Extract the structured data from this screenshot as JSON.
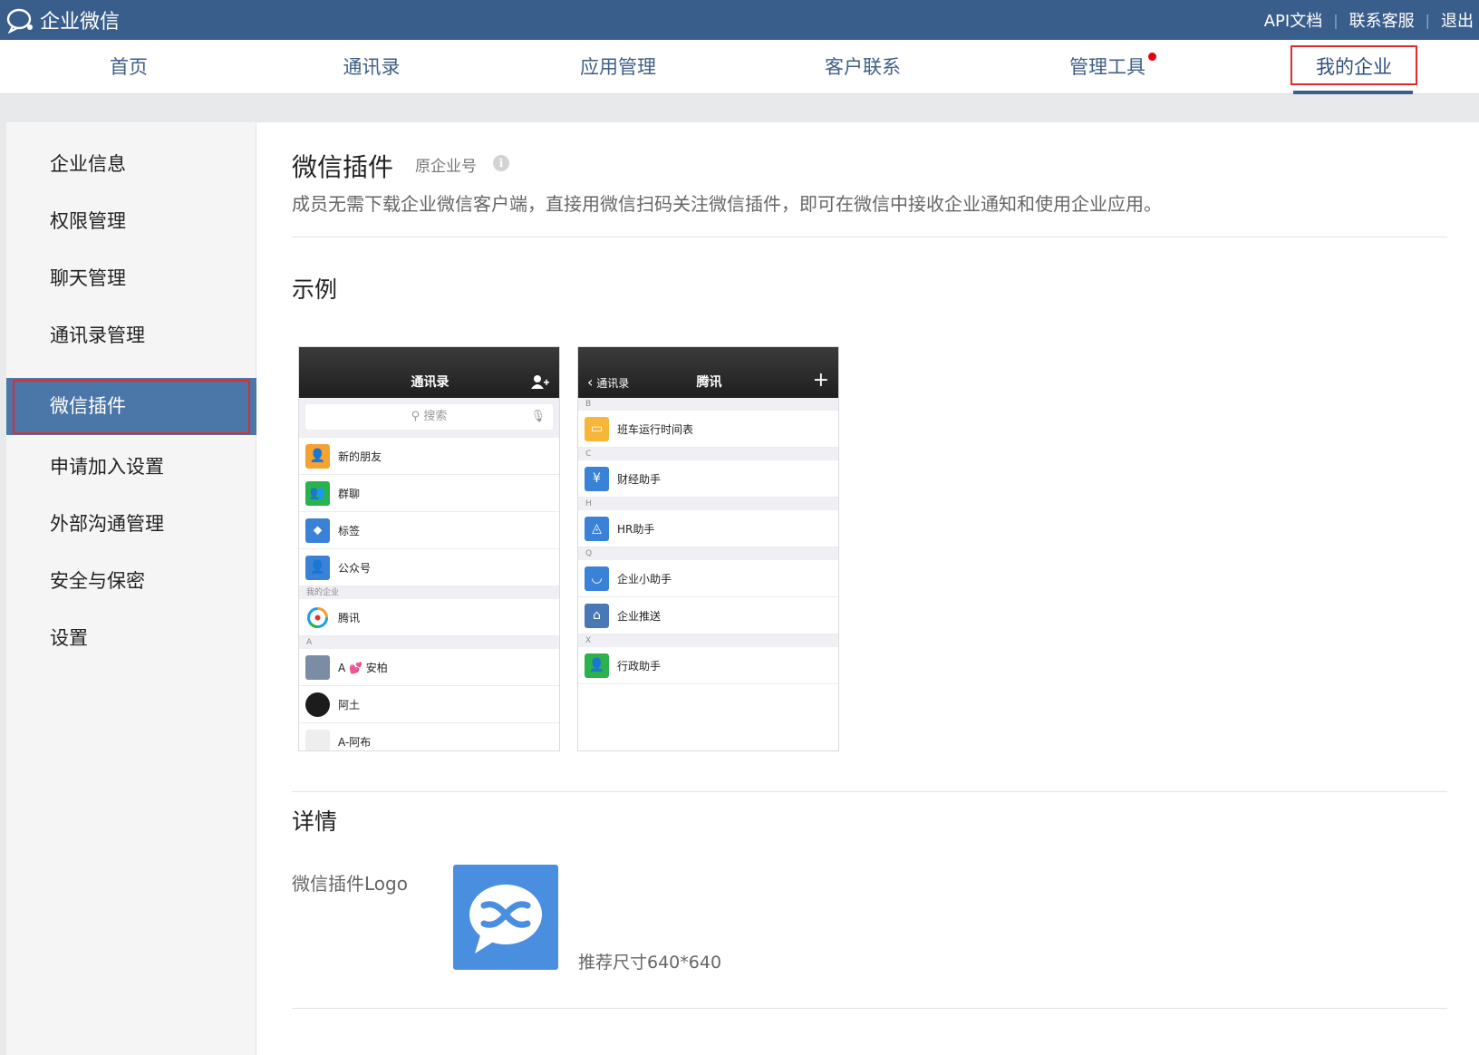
{
  "app": {
    "brand": "企业微信"
  },
  "toplinks": [
    "API文档",
    "联系客服",
    "退出"
  ],
  "nav": [
    {
      "label": "首页"
    },
    {
      "label": "通讯录"
    },
    {
      "label": "应用管理"
    },
    {
      "label": "客户联系"
    },
    {
      "label": "管理工具"
    },
    {
      "label": "我的企业"
    }
  ],
  "sidebar": [
    {
      "label": "企业信息"
    },
    {
      "label": "权限管理"
    },
    {
      "label": "聊天管理"
    },
    {
      "label": "通讯录管理"
    },
    {
      "label": "微信插件"
    },
    {
      "label": "申请加入设置"
    },
    {
      "label": "外部沟通管理"
    },
    {
      "label": "安全与保密"
    },
    {
      "label": "设置"
    }
  ],
  "content": {
    "title": "微信插件",
    "subtitle": "原企业号",
    "description": "成员无需下载企业微信客户端，直接用微信扫码关注微信插件，即可在微信中接收企业通知和使用企业应用。",
    "example_heading": "示例",
    "details_heading": "详情",
    "logo_label": "微信插件Logo",
    "logo_tip": "推荐尺寸640*640"
  },
  "phone1": {
    "title": "通讯录",
    "search": "搜索",
    "rows": [
      {
        "label": "新的朋友"
      },
      {
        "label": "群聊"
      },
      {
        "label": "标签"
      },
      {
        "label": "公众号"
      }
    ],
    "group_mycorp": "我的企业",
    "corp": "腾讯",
    "group_a": "A",
    "contacts": [
      {
        "label": "A 💕 安柏"
      },
      {
        "label": "阿土"
      },
      {
        "label": "A-阿布"
      }
    ]
  },
  "phone2": {
    "back": "通讯录",
    "title": "腾讯",
    "groups": [
      "B",
      "C",
      "H",
      "Q",
      "X"
    ],
    "rows": [
      {
        "label": "班车运行时间表"
      },
      {
        "label": "财经助手"
      },
      {
        "label": "HR助手"
      },
      {
        "label": "企业小助手"
      },
      {
        "label": "企业推送"
      },
      {
        "label": "行政助手"
      }
    ]
  },
  "colors": {
    "topbar": "#3a5e8c",
    "sidebar_active": "#4a76a8",
    "highlight_border": "#e02b2b",
    "logo_bg": "#4a8ee0"
  }
}
